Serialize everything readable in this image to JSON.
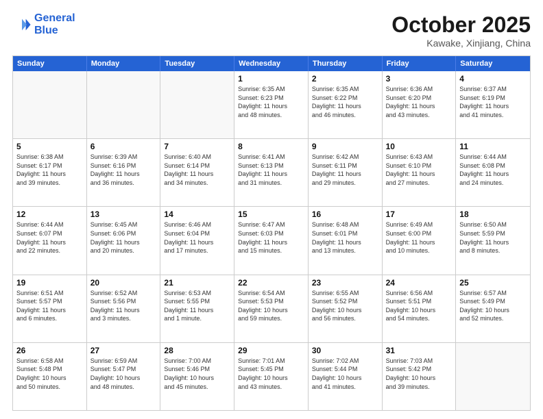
{
  "logo": {
    "line1": "General",
    "line2": "Blue"
  },
  "title": "October 2025",
  "subtitle": "Kawake, Xinjiang, China",
  "header_days": [
    "Sunday",
    "Monday",
    "Tuesday",
    "Wednesday",
    "Thursday",
    "Friday",
    "Saturday"
  ],
  "rows": [
    [
      {
        "day": "",
        "info": "",
        "empty": true
      },
      {
        "day": "",
        "info": "",
        "empty": true
      },
      {
        "day": "",
        "info": "",
        "empty": true
      },
      {
        "day": "1",
        "info": "Sunrise: 6:35 AM\nSunset: 6:23 PM\nDaylight: 11 hours\nand 48 minutes.",
        "empty": false
      },
      {
        "day": "2",
        "info": "Sunrise: 6:35 AM\nSunset: 6:22 PM\nDaylight: 11 hours\nand 46 minutes.",
        "empty": false
      },
      {
        "day": "3",
        "info": "Sunrise: 6:36 AM\nSunset: 6:20 PM\nDaylight: 11 hours\nand 43 minutes.",
        "empty": false
      },
      {
        "day": "4",
        "info": "Sunrise: 6:37 AM\nSunset: 6:19 PM\nDaylight: 11 hours\nand 41 minutes.",
        "empty": false
      }
    ],
    [
      {
        "day": "5",
        "info": "Sunrise: 6:38 AM\nSunset: 6:17 PM\nDaylight: 11 hours\nand 39 minutes.",
        "empty": false
      },
      {
        "day": "6",
        "info": "Sunrise: 6:39 AM\nSunset: 6:16 PM\nDaylight: 11 hours\nand 36 minutes.",
        "empty": false
      },
      {
        "day": "7",
        "info": "Sunrise: 6:40 AM\nSunset: 6:14 PM\nDaylight: 11 hours\nand 34 minutes.",
        "empty": false
      },
      {
        "day": "8",
        "info": "Sunrise: 6:41 AM\nSunset: 6:13 PM\nDaylight: 11 hours\nand 31 minutes.",
        "empty": false
      },
      {
        "day": "9",
        "info": "Sunrise: 6:42 AM\nSunset: 6:11 PM\nDaylight: 11 hours\nand 29 minutes.",
        "empty": false
      },
      {
        "day": "10",
        "info": "Sunrise: 6:43 AM\nSunset: 6:10 PM\nDaylight: 11 hours\nand 27 minutes.",
        "empty": false
      },
      {
        "day": "11",
        "info": "Sunrise: 6:44 AM\nSunset: 6:08 PM\nDaylight: 11 hours\nand 24 minutes.",
        "empty": false
      }
    ],
    [
      {
        "day": "12",
        "info": "Sunrise: 6:44 AM\nSunset: 6:07 PM\nDaylight: 11 hours\nand 22 minutes.",
        "empty": false
      },
      {
        "day": "13",
        "info": "Sunrise: 6:45 AM\nSunset: 6:06 PM\nDaylight: 11 hours\nand 20 minutes.",
        "empty": false
      },
      {
        "day": "14",
        "info": "Sunrise: 6:46 AM\nSunset: 6:04 PM\nDaylight: 11 hours\nand 17 minutes.",
        "empty": false
      },
      {
        "day": "15",
        "info": "Sunrise: 6:47 AM\nSunset: 6:03 PM\nDaylight: 11 hours\nand 15 minutes.",
        "empty": false
      },
      {
        "day": "16",
        "info": "Sunrise: 6:48 AM\nSunset: 6:01 PM\nDaylight: 11 hours\nand 13 minutes.",
        "empty": false
      },
      {
        "day": "17",
        "info": "Sunrise: 6:49 AM\nSunset: 6:00 PM\nDaylight: 11 hours\nand 10 minutes.",
        "empty": false
      },
      {
        "day": "18",
        "info": "Sunrise: 6:50 AM\nSunset: 5:59 PM\nDaylight: 11 hours\nand 8 minutes.",
        "empty": false
      }
    ],
    [
      {
        "day": "19",
        "info": "Sunrise: 6:51 AM\nSunset: 5:57 PM\nDaylight: 11 hours\nand 6 minutes.",
        "empty": false
      },
      {
        "day": "20",
        "info": "Sunrise: 6:52 AM\nSunset: 5:56 PM\nDaylight: 11 hours\nand 3 minutes.",
        "empty": false
      },
      {
        "day": "21",
        "info": "Sunrise: 6:53 AM\nSunset: 5:55 PM\nDaylight: 11 hours\nand 1 minute.",
        "empty": false
      },
      {
        "day": "22",
        "info": "Sunrise: 6:54 AM\nSunset: 5:53 PM\nDaylight: 10 hours\nand 59 minutes.",
        "empty": false
      },
      {
        "day": "23",
        "info": "Sunrise: 6:55 AM\nSunset: 5:52 PM\nDaylight: 10 hours\nand 56 minutes.",
        "empty": false
      },
      {
        "day": "24",
        "info": "Sunrise: 6:56 AM\nSunset: 5:51 PM\nDaylight: 10 hours\nand 54 minutes.",
        "empty": false
      },
      {
        "day": "25",
        "info": "Sunrise: 6:57 AM\nSunset: 5:49 PM\nDaylight: 10 hours\nand 52 minutes.",
        "empty": false
      }
    ],
    [
      {
        "day": "26",
        "info": "Sunrise: 6:58 AM\nSunset: 5:48 PM\nDaylight: 10 hours\nand 50 minutes.",
        "empty": false
      },
      {
        "day": "27",
        "info": "Sunrise: 6:59 AM\nSunset: 5:47 PM\nDaylight: 10 hours\nand 48 minutes.",
        "empty": false
      },
      {
        "day": "28",
        "info": "Sunrise: 7:00 AM\nSunset: 5:46 PM\nDaylight: 10 hours\nand 45 minutes.",
        "empty": false
      },
      {
        "day": "29",
        "info": "Sunrise: 7:01 AM\nSunset: 5:45 PM\nDaylight: 10 hours\nand 43 minutes.",
        "empty": false
      },
      {
        "day": "30",
        "info": "Sunrise: 7:02 AM\nSunset: 5:44 PM\nDaylight: 10 hours\nand 41 minutes.",
        "empty": false
      },
      {
        "day": "31",
        "info": "Sunrise: 7:03 AM\nSunset: 5:42 PM\nDaylight: 10 hours\nand 39 minutes.",
        "empty": false
      },
      {
        "day": "",
        "info": "",
        "empty": true
      }
    ]
  ]
}
